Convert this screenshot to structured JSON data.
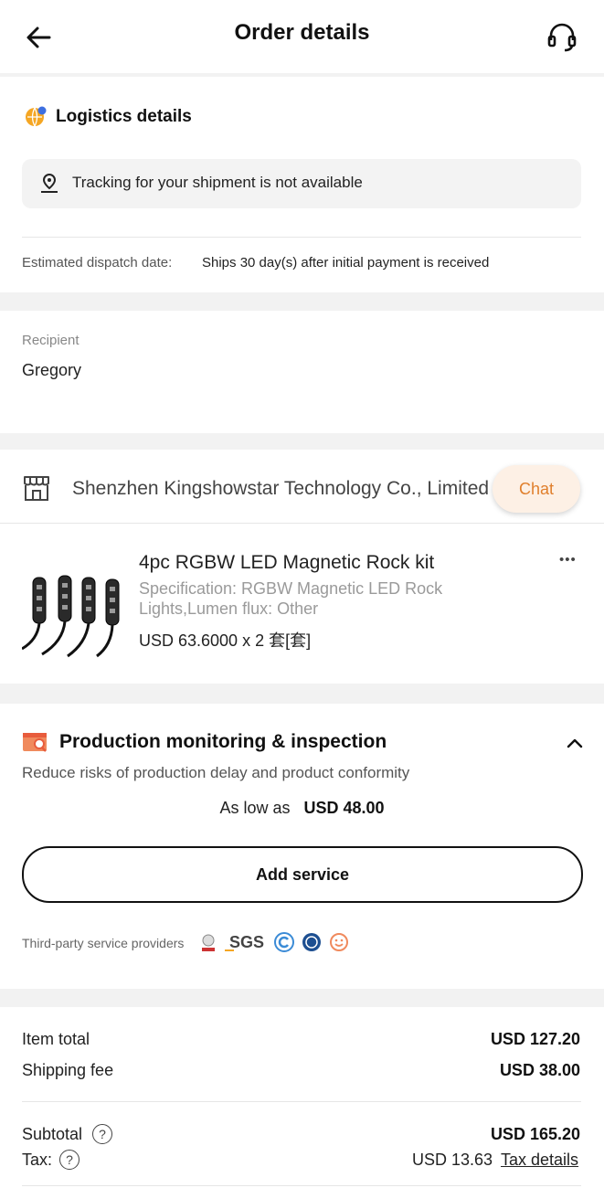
{
  "header": {
    "title": "Order details"
  },
  "logistics": {
    "title": "Logistics details",
    "tracking_text": "Tracking for your shipment is not available",
    "dispatch_label": "Estimated dispatch date:",
    "dispatch_value": "Ships 30 day(s) after initial payment is received"
  },
  "recipient": {
    "label": "Recipient",
    "name": "Gregory"
  },
  "supplier": {
    "name": "Shenzhen Kingshowstar Technology Co., Limited",
    "chat_label": "Chat",
    "product": {
      "title": "4pc RGBW LED Magnetic Rock kit",
      "spec_line1": "Specification: RGBW Magnetic LED Rock",
      "spec_line2": "Lights,Lumen flux: Other",
      "price_qty": "USD 63.6000 x 2 套[套]",
      "more_label": "•••"
    }
  },
  "monitoring": {
    "title": "Production monitoring & inspection",
    "subtitle": "Reduce risks of production delay and product conformity",
    "low_label": "As low as",
    "low_price": "USD 48.00",
    "add_button": "Add service",
    "providers_label": "Third-party service providers",
    "providers": [
      "SGS"
    ]
  },
  "totals": {
    "item_total_label": "Item total",
    "item_total_value": "USD 127.20",
    "shipping_label": "Shipping fee",
    "shipping_value": "USD 38.00",
    "subtotal_label": "Subtotal",
    "subtotal_value": "USD 165.20",
    "tax_label": "Tax:",
    "tax_value": "USD 13.63",
    "tax_details_link": "Tax details",
    "help_glyph": "?"
  },
  "colors": {
    "chat_text": "#e07f2c",
    "chat_bg": "#fdf0e5",
    "page_bg": "#f2f2f2"
  }
}
